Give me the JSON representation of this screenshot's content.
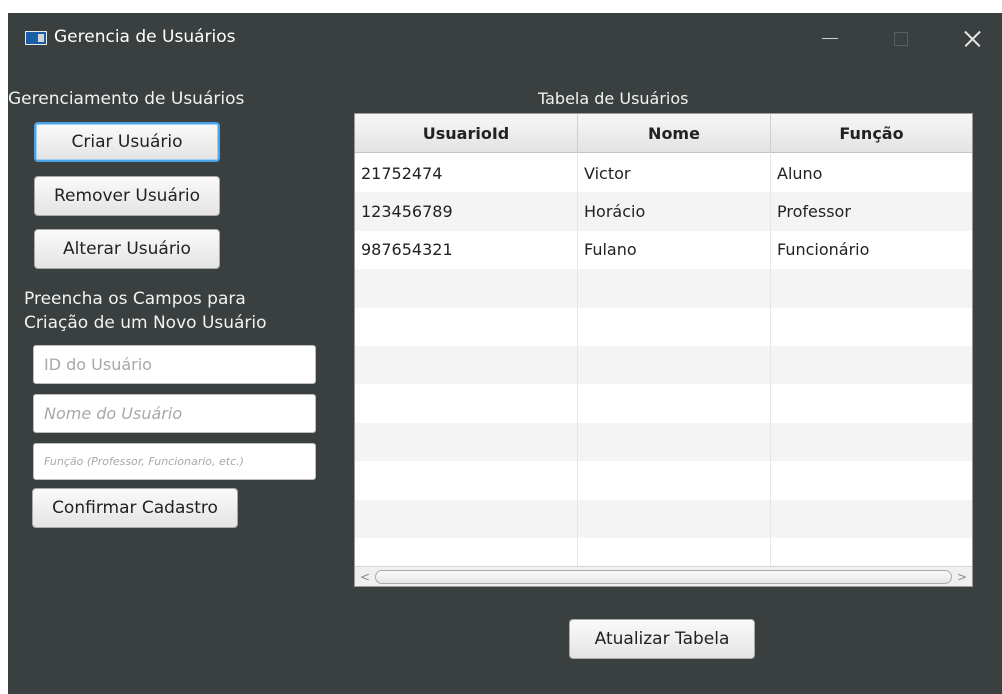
{
  "window": {
    "title": "Gerencia de Usuários"
  },
  "left_panel": {
    "section_label": "Gerenciamento de Usuários",
    "create_label": "Criar Usuário",
    "remove_label": "Remover Usuário",
    "alter_label": "Alterar Usuário",
    "fill_label": "Preencha os Campos para Criação de um Novo Usuário",
    "id_placeholder": "ID do Usuário",
    "name_placeholder": "Nome do Usuário",
    "role_placeholder": "Função (Professor, Funcionario, etc.)",
    "confirm_label": "Confirmar Cadastro"
  },
  "table": {
    "title": "Tabela de Usuários",
    "columns": [
      "UsuarioId",
      "Nome",
      "Função"
    ],
    "rows": [
      [
        "21752474",
        "Victor",
        "Aluno"
      ],
      [
        "123456789",
        "Horácio",
        "Professor"
      ],
      [
        "987654321",
        "Fulano",
        "Funcionário"
      ]
    ],
    "scroll_left": "<",
    "scroll_right": ">"
  },
  "footer": {
    "refresh_label": "Atualizar Tabela"
  },
  "icons": {
    "app": "window-app-icon",
    "minimize": "minimize-icon",
    "maximize": "maximize-icon",
    "close": "close-icon"
  },
  "colors": {
    "background": "#3a3f3f",
    "focus_border": "#4aa3e6"
  }
}
